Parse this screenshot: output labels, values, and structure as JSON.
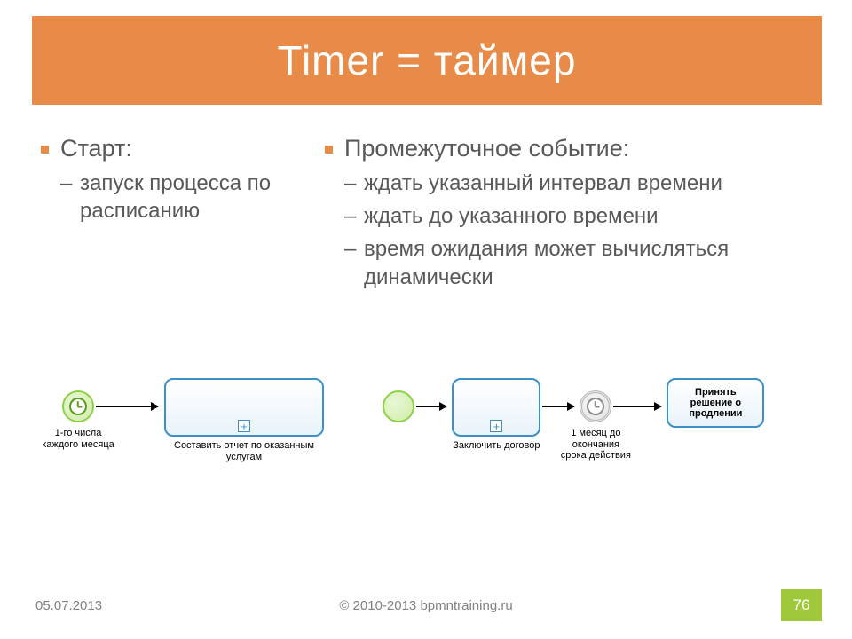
{
  "title": "Timer = таймер",
  "left": {
    "heading": "Старт:",
    "items": [
      "запуск процесса по расписанию"
    ]
  },
  "right": {
    "heading": "Промежуточное событие:",
    "items": [
      "ждать указанный интервал времени",
      "ждать до указанного времени",
      "время ожидания может вычисляться динамически"
    ]
  },
  "diagram1": {
    "start_label": "1-го числа каждого месяца",
    "task_label": "Составить отчет по оказанным услугам"
  },
  "diagram2": {
    "task1_label": "Заключить договор",
    "timer_label": "1 месяц до окончания срока действия",
    "task2_label": "Принять решение о продлении"
  },
  "footer": {
    "date": "05.07.2013",
    "copyright": "© 2010-2013 bpmntraining.ru",
    "page": "76"
  }
}
